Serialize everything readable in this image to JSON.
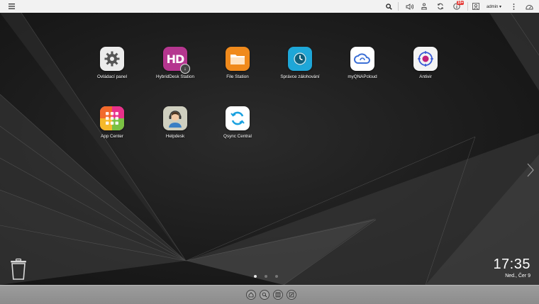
{
  "topbar": {
    "menu_icon": "hamburger-icon",
    "search_icon": "search-icon",
    "volume_icon": "volume-icon",
    "tasks_icon": "background-tasks-icon",
    "sync_icon": "sync-icon",
    "notifications_icon": "info-icon",
    "notifications_badge": "10+",
    "user_label": "admin ▾",
    "more_icon": "more-vertical-icon",
    "dashboard_icon": "dashboard-gauge-icon"
  },
  "apps": [
    {
      "label": "Ovládací panel",
      "icon": "gear-icon",
      "color": "#ececec"
    },
    {
      "label": "HybridDesk Station",
      "icon": "hd-station-icon",
      "color": "#b5368f"
    },
    {
      "label": "File Station",
      "icon": "folder-icon",
      "color": "#f08a1c"
    },
    {
      "label": "Správce zálohování",
      "icon": "clock-icon",
      "color": "#1ea7d8"
    },
    {
      "label": "myQNAPcloud",
      "icon": "cloud-icon",
      "color": "#ffffff"
    },
    {
      "label": "Antivir",
      "icon": "virus-shield-icon",
      "color": "#f3f3f3"
    },
    {
      "label": "App Center",
      "icon": "app-grid-icon",
      "color": "#ffffff"
    },
    {
      "label": "Helpdesk",
      "icon": "support-agent-icon",
      "color": "#cfcfbf"
    },
    {
      "label": "Qsync Central",
      "icon": "sync-arrows-icon",
      "color": "#ffffff"
    }
  ],
  "clock": {
    "time": "17:35",
    "date": "Ned., Čer 9"
  },
  "pager": {
    "pages": 3,
    "active": 1
  },
  "dock": [
    "home-icon",
    "search-app-icon",
    "grid-icon",
    "edit-icon"
  ]
}
